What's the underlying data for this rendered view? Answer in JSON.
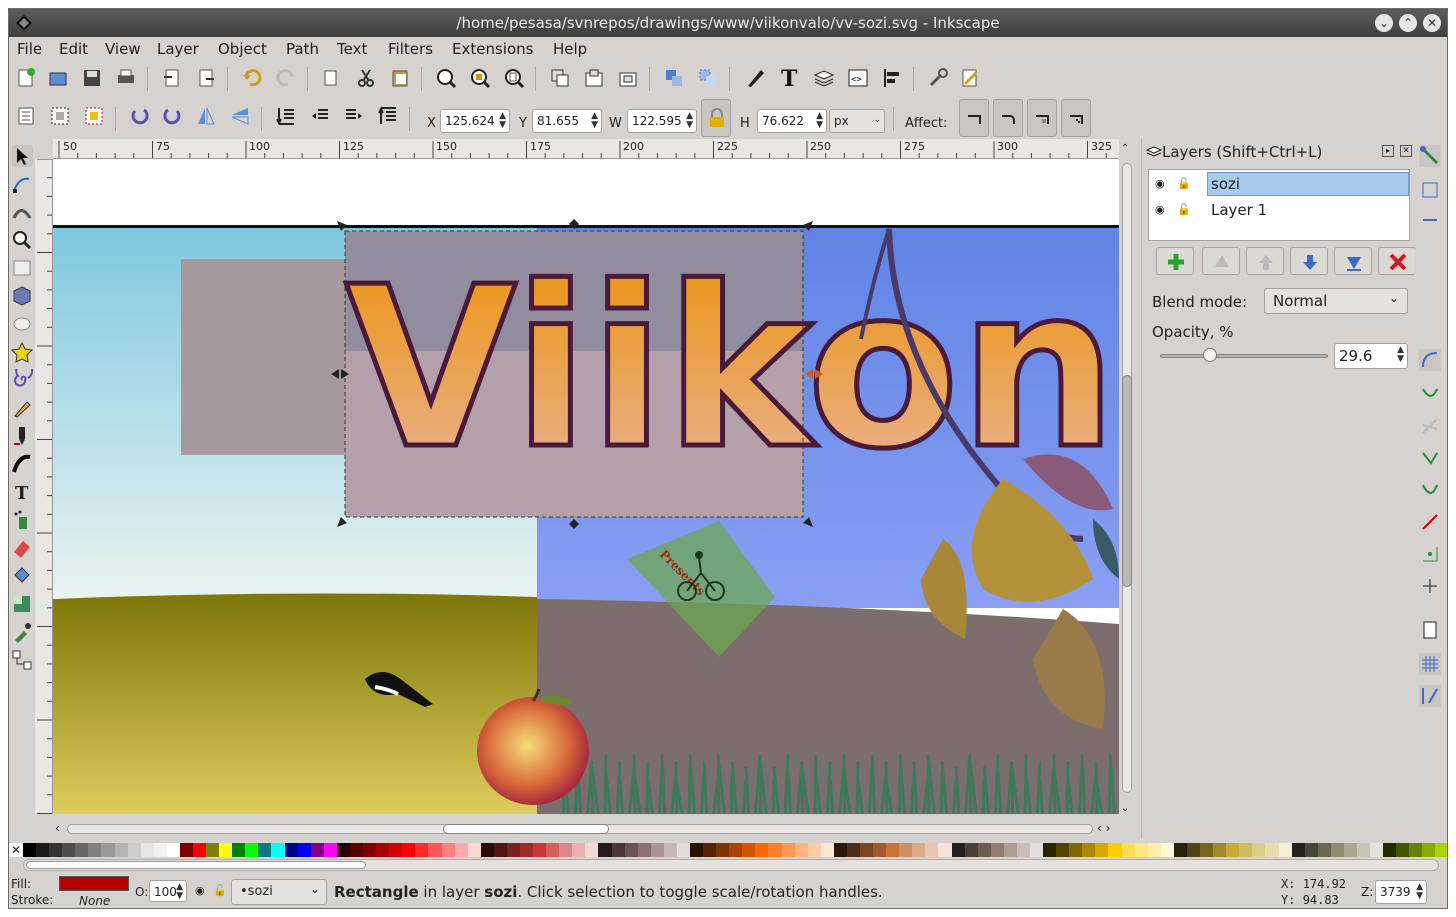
{
  "window": {
    "title": "/home/pesasa/svnrepos/drawings/www/viikonvalo/vv-sozi.svg - Inkscape"
  },
  "menu": [
    "File",
    "Edit",
    "View",
    "Layer",
    "Object",
    "Path",
    "Text",
    "Filters",
    "Extensions",
    "Help"
  ],
  "select_toolbar": {
    "x_label": "X",
    "x_value": "125.624",
    "y_label": "Y",
    "y_value": "81.655",
    "w_label": "W",
    "w_value": "122.595",
    "h_label": "H",
    "h_value": "76.622",
    "unit": "px",
    "affect_label": "Affect:"
  },
  "ruler": {
    "h_ticks": [
      "50",
      "75",
      "100",
      "125",
      "150",
      "175",
      "200",
      "225",
      "250",
      "275",
      "300",
      "325"
    ]
  },
  "canvas": {
    "title_text": "Viikon V",
    "presents_text": "Presents"
  },
  "layers_panel": {
    "title": "Layers (Shift+Ctrl+L)",
    "layers": [
      {
        "name": "sozi",
        "selected": true
      },
      {
        "name": "Layer 1",
        "selected": false
      }
    ],
    "blend_label": "Blend mode:",
    "blend_value": "Normal",
    "opacity_label": "Opacity, %",
    "opacity_value": "29.6",
    "opacity_fraction": 0.296
  },
  "status": {
    "fill_label": "Fill:",
    "stroke_label": "Stroke:",
    "stroke_value": "None",
    "fill_color": "#b30000",
    "opacity_label": "O:",
    "opacity_value": "100",
    "layer_value": "•sozi",
    "msg_bold_1": "Rectangle",
    "msg_1": " in layer ",
    "msg_bold_2": "sozi",
    "msg_2": ". Click selection to toggle scale/rotation handles.",
    "x_label": "X:",
    "x_value": "174.92",
    "y_label": "Y:",
    "y_value": "94.83",
    "zoom_label": "Z:",
    "zoom_value": "3739"
  },
  "palette_colors": [
    "#000000",
    "#1a1a1a",
    "#333333",
    "#4d4d4d",
    "#666666",
    "#808080",
    "#999999",
    "#b3b3b3",
    "#cccccc",
    "#e6e6e6",
    "#f2f2f2",
    "#ffffff",
    "#800000",
    "#ff0000",
    "#808000",
    "#ffff00",
    "#008000",
    "#00ff00",
    "#008080",
    "#00ffff",
    "#000080",
    "#0000ff",
    "#800080",
    "#ff00ff",
    "#2b0000",
    "#550000",
    "#800000",
    "#aa0000",
    "#d40000",
    "#ff0000",
    "#ff2a2a",
    "#ff5555",
    "#ff8080",
    "#ffaaaa",
    "#ffd5d5",
    "#280b0b",
    "#501616",
    "#782121",
    "#a02c2c",
    "#c83737",
    "#d35f5f",
    "#de8787",
    "#e9afaf",
    "#f4d7d7",
    "#241c1c",
    "#483737",
    "#6c5353",
    "#916f6f",
    "#ac9393",
    "#c8b7b7",
    "#e3dbdb",
    "#2b1100",
    "#552200",
    "#803300",
    "#aa4400",
    "#d45500",
    "#ff6600",
    "#ff7f2a",
    "#ff9955",
    "#ffb380",
    "#ffccaa",
    "#ffe6d5",
    "#28170b",
    "#502d16",
    "#784421",
    "#a05a2c",
    "#c87137",
    "#d38d5f",
    "#deaa87",
    "#e9c6af",
    "#f4e3d7",
    "#241f1c",
    "#483e37",
    "#6c5d53",
    "#917c6f",
    "#ac9d93",
    "#c8beb7",
    "#e3dedb",
    "#2b2200",
    "#554400",
    "#806600",
    "#aa8800",
    "#d4aa00",
    "#ffcc00",
    "#ffdd55",
    "#ffe680",
    "#ffeeaa",
    "#fff6d5",
    "#28220b",
    "#504416",
    "#786721",
    "#a0892c",
    "#c8ab37",
    "#d3bc5f",
    "#decd87",
    "#e9ddaf",
    "#f4eed7",
    "#24221c",
    "#484537",
    "#6c6753",
    "#918a6f",
    "#aca793",
    "#c8c4b7",
    "#e3e2db",
    "#222b00",
    "#445500",
    "#668000",
    "#88aa00",
    "#aad400"
  ],
  "icons": [
    "new-document-icon",
    "open-icon",
    "save-icon",
    "print-icon",
    "import-icon",
    "export-icon",
    "undo-icon",
    "redo-icon",
    "copy-icon",
    "cut-icon",
    "paste-icon",
    "zoom-selection-icon",
    "zoom-drawing-icon",
    "zoom-page-icon",
    "duplicate-icon",
    "clone-icon",
    "unlink-clone-icon",
    "group-icon",
    "ungroup-icon",
    "fill-stroke-icon",
    "text-font-icon",
    "layers-icon",
    "xml-editor-icon",
    "align-icon",
    "preferences-icon",
    "document-properties-icon"
  ]
}
